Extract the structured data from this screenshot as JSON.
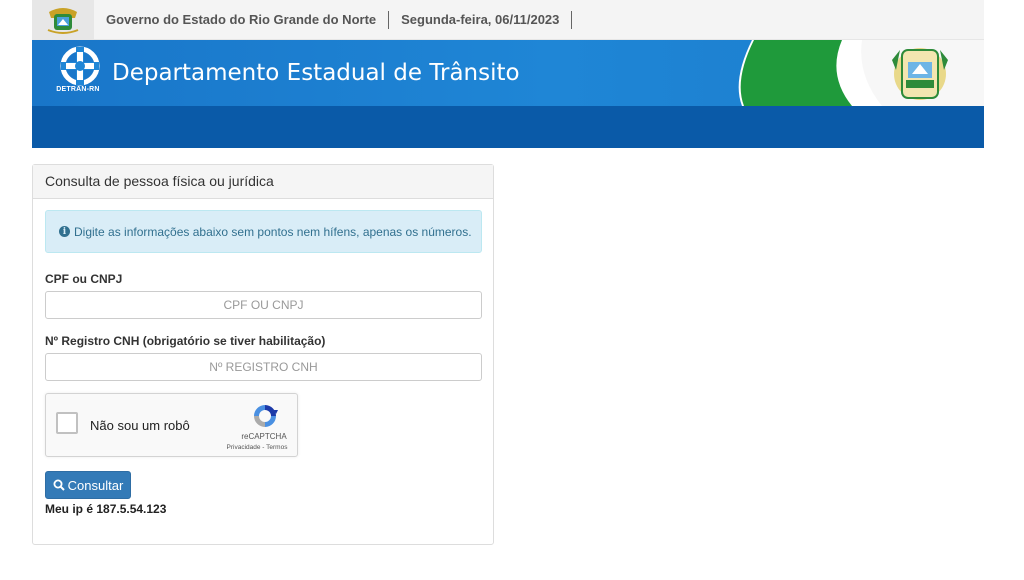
{
  "topbar": {
    "government_name": "Governo do Estado do Rio Grande do Norte",
    "date": "Segunda-feira, 06/11/2023"
  },
  "header": {
    "logo_text": "DETRAN-RN",
    "title": "Departamento Estadual de Trânsito"
  },
  "panel": {
    "heading": "Consulta de pessoa física ou jurídica",
    "alert_text": "Digite as informações abaixo sem pontos nem hífens, apenas os números.",
    "cpf_label": "CPF ou CNPJ",
    "cpf_value": "",
    "cpf_placeholder": "CPF OU CNPJ",
    "cnh_label": "Nº Registro CNH (obrigatório se tiver habilitação)",
    "cnh_value": "",
    "cnh_placeholder": "Nº REGISTRO CNH",
    "recaptcha": {
      "label": "Não sou um robô",
      "brand": "reCAPTCHA",
      "links": "Privacidade - Termos"
    },
    "submit_label": "Consultar",
    "ip_text": "Meu ip é 187.5.54.123"
  },
  "colors": {
    "header_blue": "#1f86d6",
    "subheader_blue": "#0a5aa8",
    "button_blue": "#337ab7",
    "alert_bg": "#d9edf7"
  }
}
